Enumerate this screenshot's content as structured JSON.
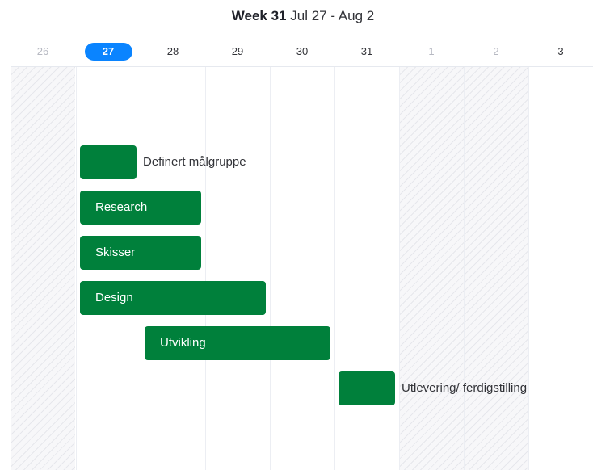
{
  "header": {
    "week_label": "Week 31",
    "date_range": "Jul 27 - Aug 2"
  },
  "days": [
    {
      "label": "26",
      "weekend": true,
      "today": false
    },
    {
      "label": "27",
      "weekend": false,
      "today": true
    },
    {
      "label": "28",
      "weekend": false,
      "today": false
    },
    {
      "label": "29",
      "weekend": false,
      "today": false
    },
    {
      "label": "30",
      "weekend": false,
      "today": false
    },
    {
      "label": "31",
      "weekend": false,
      "today": false
    },
    {
      "label": "1",
      "weekend": true,
      "today": false
    },
    {
      "label": "2",
      "weekend": true,
      "today": false
    },
    {
      "label": "3",
      "weekend": false,
      "today": false
    }
  ],
  "tasks": {
    "t0": {
      "label": "Definert målgruppe",
      "start_day": "27",
      "end_day": "27"
    },
    "t1": {
      "label": "Research",
      "start_day": "27",
      "end_day": "28"
    },
    "t2": {
      "label": "Skisser",
      "start_day": "27",
      "end_day": "28"
    },
    "t3": {
      "label": "Design",
      "start_day": "27",
      "end_day": "29"
    },
    "t4": {
      "label": "Utvikling",
      "start_day": "28",
      "end_day": "30"
    },
    "t5": {
      "label": "Utlevering/ ferdigstilling",
      "start_day": "31",
      "end_day": "31"
    }
  },
  "colors": {
    "task_bar": "#00803b",
    "today_pill": "#0a84ff",
    "weekend_text": "#b7b9c2",
    "text": "#323338"
  }
}
